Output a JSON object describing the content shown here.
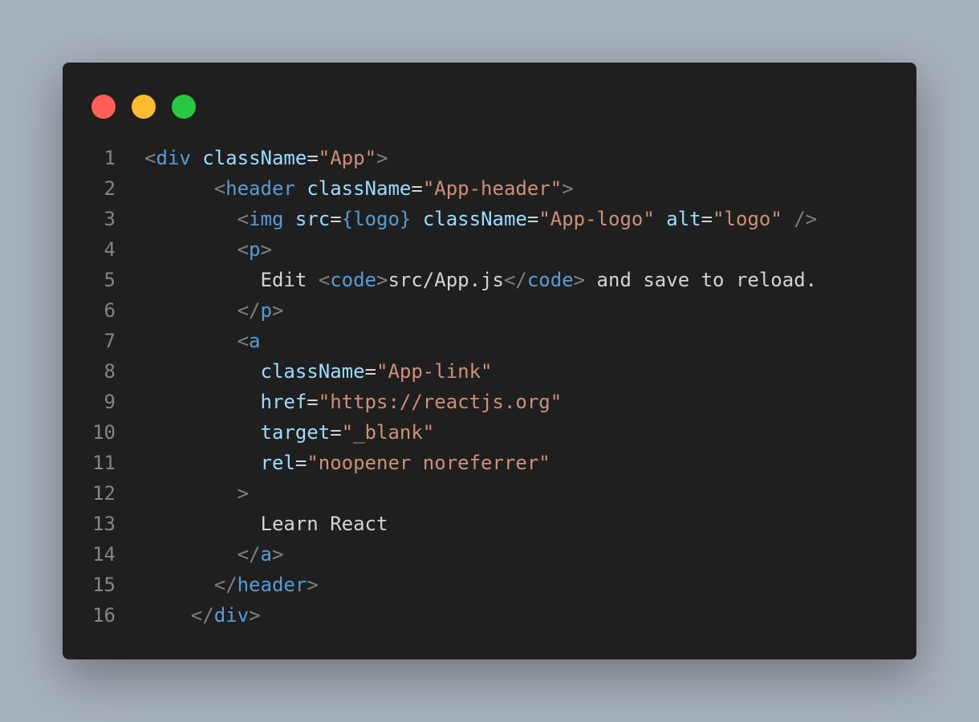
{
  "window": {
    "buttons": [
      {
        "name": "close",
        "color": "#ff5f57"
      },
      {
        "name": "minimize",
        "color": "#febc2e"
      },
      {
        "name": "maximize",
        "color": "#28c840"
      }
    ]
  },
  "colors": {
    "background": "#a7b1bb",
    "editor_bg": "#1f1f1f",
    "punct": "#808080",
    "tag": "#569cd6",
    "attr": "#9cdcfe",
    "string": "#ce9178",
    "text": "#d4d4d4",
    "line_number": "#858585"
  },
  "code": {
    "lines": [
      {
        "number": "1",
        "tokens": [
          [
            "",
            "text"
          ],
          [
            "<",
            "punct"
          ],
          [
            "div",
            "tag"
          ],
          [
            " ",
            "text"
          ],
          [
            "className",
            "attr"
          ],
          [
            "=",
            "text"
          ],
          [
            "\"App\"",
            "string"
          ],
          [
            ">",
            "punct"
          ]
        ]
      },
      {
        "number": "2",
        "tokens": [
          [
            "      ",
            "text"
          ],
          [
            "<",
            "punct"
          ],
          [
            "header",
            "tag"
          ],
          [
            " ",
            "text"
          ],
          [
            "className",
            "attr"
          ],
          [
            "=",
            "text"
          ],
          [
            "\"App-header\"",
            "string"
          ],
          [
            ">",
            "punct"
          ]
        ]
      },
      {
        "number": "3",
        "tokens": [
          [
            "        ",
            "text"
          ],
          [
            "<",
            "punct"
          ],
          [
            "img",
            "tag"
          ],
          [
            " ",
            "text"
          ],
          [
            "src",
            "attr"
          ],
          [
            "=",
            "text"
          ],
          [
            "{logo}",
            "tag"
          ],
          [
            " ",
            "text"
          ],
          [
            "className",
            "attr"
          ],
          [
            "=",
            "text"
          ],
          [
            "\"App-logo\"",
            "string"
          ],
          [
            " ",
            "text"
          ],
          [
            "alt",
            "attr"
          ],
          [
            "=",
            "text"
          ],
          [
            "\"logo\"",
            "string"
          ],
          [
            " ",
            "text"
          ],
          [
            "/>",
            "punct"
          ]
        ]
      },
      {
        "number": "4",
        "tokens": [
          [
            "        ",
            "text"
          ],
          [
            "<",
            "punct"
          ],
          [
            "p",
            "tag"
          ],
          [
            ">",
            "punct"
          ]
        ]
      },
      {
        "number": "5",
        "tokens": [
          [
            "          ",
            "text"
          ],
          [
            "Edit ",
            "text"
          ],
          [
            "<",
            "punct"
          ],
          [
            "code",
            "tag"
          ],
          [
            ">",
            "punct"
          ],
          [
            "src/App.js",
            "text"
          ],
          [
            "</",
            "punct"
          ],
          [
            "code",
            "tag"
          ],
          [
            ">",
            "punct"
          ],
          [
            " and save to reload.",
            "text"
          ]
        ]
      },
      {
        "number": "6",
        "tokens": [
          [
            "        ",
            "text"
          ],
          [
            "</",
            "punct"
          ],
          [
            "p",
            "tag"
          ],
          [
            ">",
            "punct"
          ]
        ]
      },
      {
        "number": "7",
        "tokens": [
          [
            "        ",
            "text"
          ],
          [
            "<",
            "punct"
          ],
          [
            "a",
            "tag"
          ]
        ]
      },
      {
        "number": "8",
        "tokens": [
          [
            "          ",
            "text"
          ],
          [
            "className",
            "attr"
          ],
          [
            "=",
            "text"
          ],
          [
            "\"App-link\"",
            "string"
          ]
        ]
      },
      {
        "number": "9",
        "tokens": [
          [
            "          ",
            "text"
          ],
          [
            "href",
            "attr"
          ],
          [
            "=",
            "text"
          ],
          [
            "\"https://reactjs.org\"",
            "string"
          ]
        ]
      },
      {
        "number": "10",
        "tokens": [
          [
            "          ",
            "text"
          ],
          [
            "target",
            "attr"
          ],
          [
            "=",
            "text"
          ],
          [
            "\"_blank\"",
            "string"
          ]
        ]
      },
      {
        "number": "11",
        "tokens": [
          [
            "          ",
            "text"
          ],
          [
            "rel",
            "attr"
          ],
          [
            "=",
            "text"
          ],
          [
            "\"noopener noreferrer\"",
            "string"
          ]
        ]
      },
      {
        "number": "12",
        "tokens": [
          [
            "        ",
            "text"
          ],
          [
            ">",
            "punct"
          ]
        ]
      },
      {
        "number": "13",
        "tokens": [
          [
            "          ",
            "text"
          ],
          [
            "Learn React",
            "text"
          ]
        ]
      },
      {
        "number": "14",
        "tokens": [
          [
            "        ",
            "text"
          ],
          [
            "</",
            "punct"
          ],
          [
            "a",
            "tag"
          ],
          [
            ">",
            "punct"
          ]
        ]
      },
      {
        "number": "15",
        "tokens": [
          [
            "      ",
            "text"
          ],
          [
            "</",
            "punct"
          ],
          [
            "header",
            "tag"
          ],
          [
            ">",
            "punct"
          ]
        ]
      },
      {
        "number": "16",
        "tokens": [
          [
            "    ",
            "text"
          ],
          [
            "</",
            "punct"
          ],
          [
            "div",
            "tag"
          ],
          [
            ">",
            "punct"
          ]
        ]
      }
    ]
  }
}
